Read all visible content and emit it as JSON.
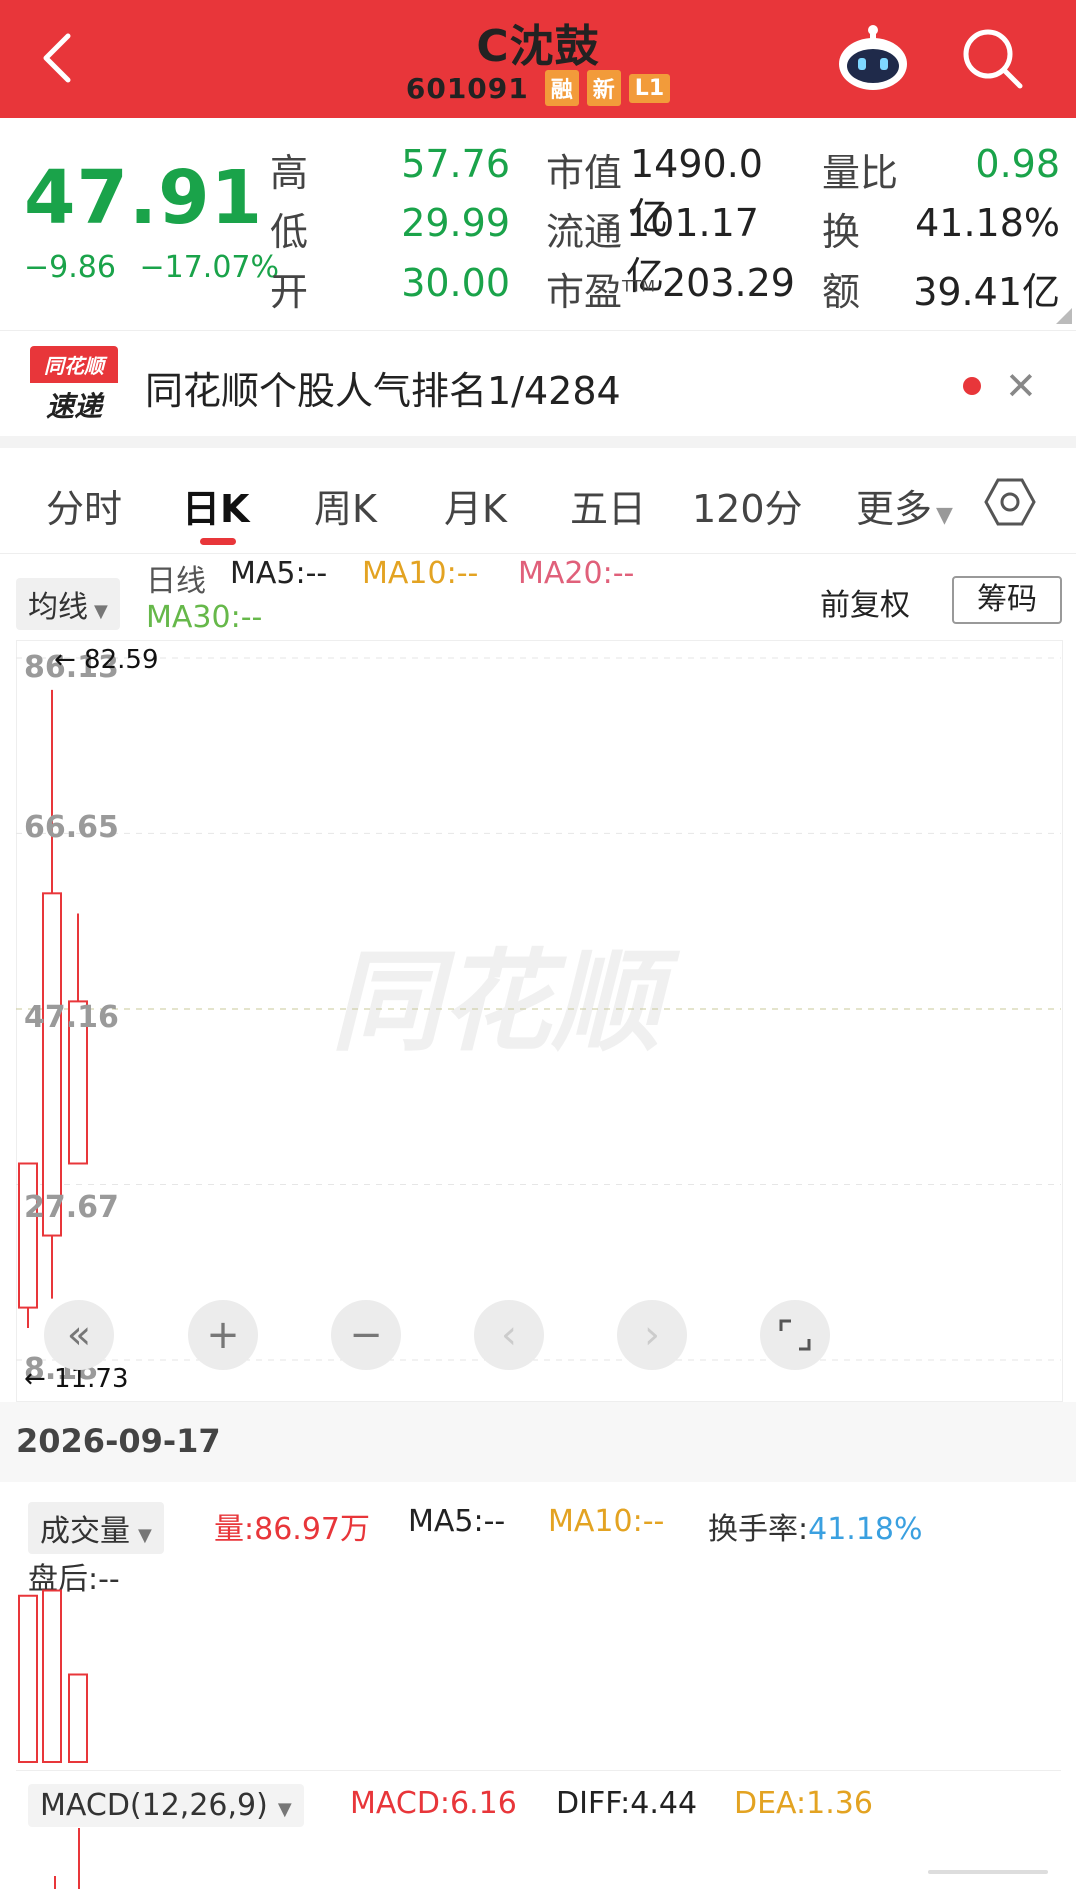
{
  "header": {
    "title": "C沈鼓",
    "code": "601091",
    "tags": [
      "融",
      "新",
      "L1"
    ],
    "bg_color": "#e8363a"
  },
  "quote": {
    "price": "47.91",
    "change": "−9.86",
    "change_pct": "−17.07%",
    "rows": [
      {
        "l1": "高",
        "v1": "57.76",
        "l2": "市值",
        "v2": "1490.0亿",
        "l3": "量比",
        "v3": "0.98"
      },
      {
        "l1": "低",
        "v1": "29.99",
        "l2": "流通",
        "v2": "101.17亿",
        "l3": "换",
        "v3": "41.18%"
      },
      {
        "l1": "开",
        "v1": "30.00",
        "l2": "市盈",
        "v2": "203.29",
        "l3": "额",
        "v3": "39.41亿"
      }
    ],
    "ttm_label": "TTM",
    "down_color": "#1aa34a"
  },
  "rank_banner": {
    "logo_top": "同花顺",
    "logo_bottom": "速递",
    "text": "同花顺个股人气排名1/4284"
  },
  "period_tabs": [
    "分时",
    "日K",
    "周K",
    "月K",
    "五日",
    "120分",
    "更多"
  ],
  "active_tab": "日K",
  "ma_row": {
    "selector": "均线",
    "prefix": "日线",
    "ma5": "MA5:--",
    "ma10": "MA10:--",
    "ma20": "MA20:--",
    "ma30": "MA30:--",
    "adjust": "前复权",
    "chips_button": "筹码"
  },
  "kline": {
    "y_axis_labels": [
      "86.13",
      "66.65",
      "47.16",
      "27.67",
      "8.18"
    ],
    "high_marker": "← 82.59",
    "low_marker": "← 11.73",
    "watermark": "同花顺",
    "candles": [
      {
        "open": 30.0,
        "close": 14.0,
        "high": 30.0,
        "low": 11.73
      },
      {
        "open": 22.0,
        "close": 60.0,
        "high": 82.59,
        "low": 15.0
      },
      {
        "open": 30.0,
        "close": 48.0,
        "high": 57.76,
        "low": 29.99
      }
    ]
  },
  "date": "2026-09-17",
  "volume": {
    "selector": "成交量",
    "amount": "量:86.97万",
    "ma5": "MA5:--",
    "ma10": "MA10:--",
    "turnover_label": "换手率:",
    "turnover_value": "41.18%",
    "after_hours": "盘后:--",
    "bars": [
      0.95,
      0.98,
      0.5
    ]
  },
  "macd": {
    "selector": "MACD(12,26,9)",
    "macd": "MACD:6.16",
    "diff": "DIFF:4.44",
    "dea": "DEA:1.36"
  },
  "colors": {
    "up": "#e8363a",
    "ma10": "#e3a322",
    "ma20": "#e0607a",
    "ma30": "#66b84a",
    "turnover": "#3aa0e0"
  }
}
